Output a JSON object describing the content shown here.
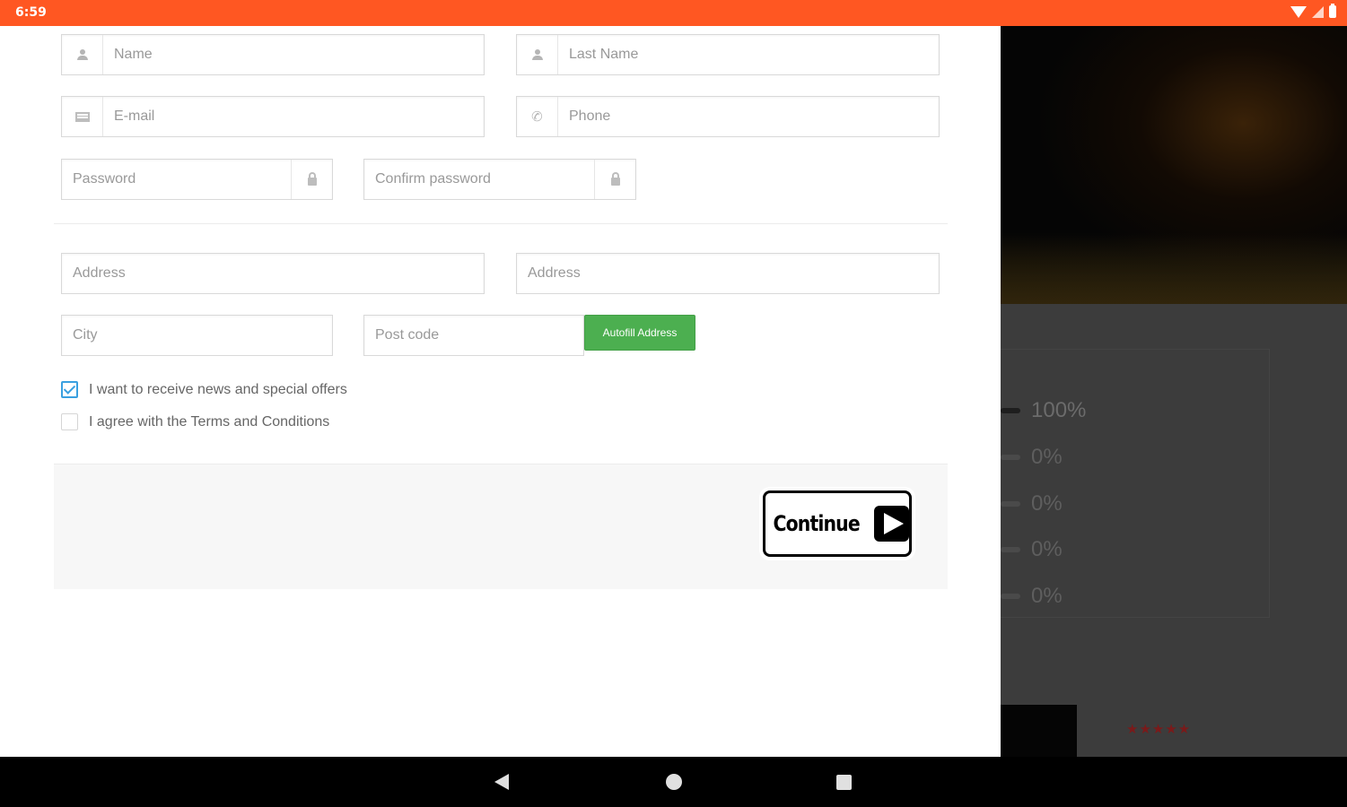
{
  "status_bar": {
    "time": "6:59",
    "icons": [
      "wifi-icon",
      "signal-icon",
      "battery-icon"
    ],
    "color": "#FF5722"
  },
  "form": {
    "name": {
      "placeholder": "Name",
      "icon": "user-icon"
    },
    "last_name": {
      "placeholder": "Last Name",
      "icon": "user-icon"
    },
    "email": {
      "placeholder": "E-mail",
      "icon": "mail-icon"
    },
    "phone": {
      "placeholder": "Phone",
      "icon": "phone-icon"
    },
    "password": {
      "placeholder": "Password",
      "icon": "lock-icon"
    },
    "confirm_password": {
      "placeholder": "Confirm password",
      "icon": "lock-icon"
    },
    "address_1": {
      "placeholder": "Address"
    },
    "address_2": {
      "placeholder": "Address"
    },
    "city": {
      "placeholder": "City"
    },
    "post_code": {
      "placeholder": "Post code"
    },
    "autofill_label": "Autofill Address",
    "autofill_color": "#4CAF50",
    "news_checkbox": {
      "label": "I want to receive news and special offers",
      "checked": true
    },
    "terms_checkbox": {
      "label": "I agree with the Terms and Conditions",
      "checked": false
    },
    "continue_label": "Continue"
  },
  "background": {
    "ratings": [
      {
        "percent": "100%",
        "level": 1.0
      },
      {
        "percent": "0%",
        "level": 0
      },
      {
        "percent": "0%",
        "level": 0
      },
      {
        "percent": "0%",
        "level": 0
      },
      {
        "percent": "0%",
        "level": 0
      }
    ],
    "stars": "★★★★★"
  },
  "nav_bar": {
    "buttons": [
      "back-icon",
      "home-icon",
      "recents-icon"
    ]
  }
}
